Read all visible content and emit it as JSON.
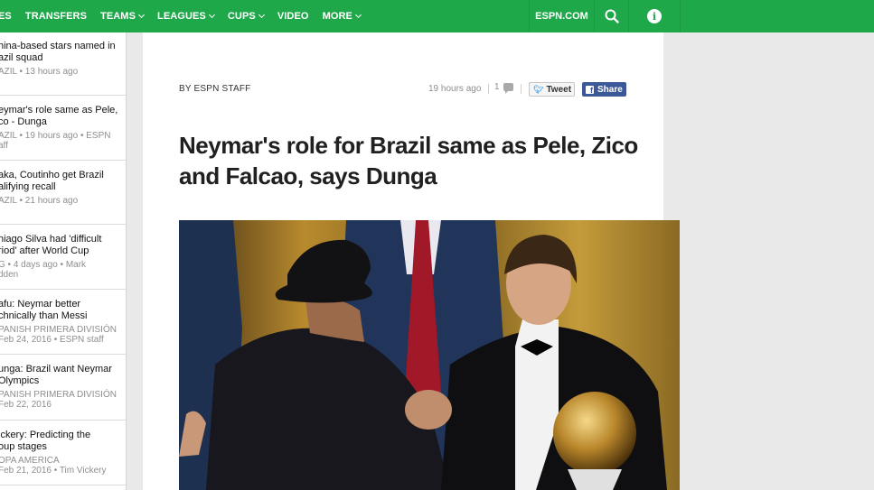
{
  "nav": {
    "items": [
      {
        "label": "ES",
        "has_menu": false
      },
      {
        "label": "TRANSFERS",
        "has_menu": false
      },
      {
        "label": "TEAMS",
        "has_menu": true
      },
      {
        "label": "LEAGUES",
        "has_menu": true
      },
      {
        "label": "CUPS",
        "has_menu": true
      },
      {
        "label": "VIDEO",
        "has_menu": false
      },
      {
        "label": "MORE",
        "has_menu": true
      }
    ],
    "site_link": "ESPN.COM",
    "search_icon": "search-icon",
    "info_icon": "info-icon",
    "info_glyph": "i",
    "colors": {
      "nav_bg": "#1fa84a",
      "text": "#ffffff"
    }
  },
  "sidebar": {
    "items": [
      {
        "title": "hina-based stars named in\nazil squad",
        "meta": "AZIL • 13 hours ago"
      },
      {
        "title": "eymar's role same as Pele,\nco - Dunga",
        "meta": "AZIL • 19 hours ago • ESPN\naff"
      },
      {
        "title": "aka, Coutinho get Brazil\nalifying recall",
        "meta": "AZIL • 21 hours ago"
      },
      {
        "title": "hiago Silva had 'difficult\nriod' after World Cup",
        "meta": "G • 4 days ago • Mark\ndden"
      },
      {
        "title": "afu: Neymar better\nchnically than Messi",
        "meta": "PANISH PRIMERA DIVISIÓN\nFeb 24, 2016 • ESPN staff"
      },
      {
        "title": "unga: Brazil want Neymar\nOlympics",
        "meta": "PANISH PRIMERA DIVISIÓN\nFeb 22, 2016"
      },
      {
        "title": "ickery: Predicting the\noup stages",
        "meta": "OPA AMERICA\nFeb 21, 2016 • Tim Vickery"
      }
    ]
  },
  "article": {
    "byline": "BY ESPN STAFF",
    "timestamp": "19 hours ago",
    "comment_count": "1",
    "tweet_label": "Tweet",
    "share_label": "Share",
    "facebook_glyph": "f",
    "headline": "Neymar's role for Brazil same as Pele, Zico and Falcao, says Dunga",
    "photo": "photo of two footballers in suits shaking hands",
    "colors": {
      "share_bg": "#3b5998",
      "tweet_bird": "#55acee"
    }
  }
}
